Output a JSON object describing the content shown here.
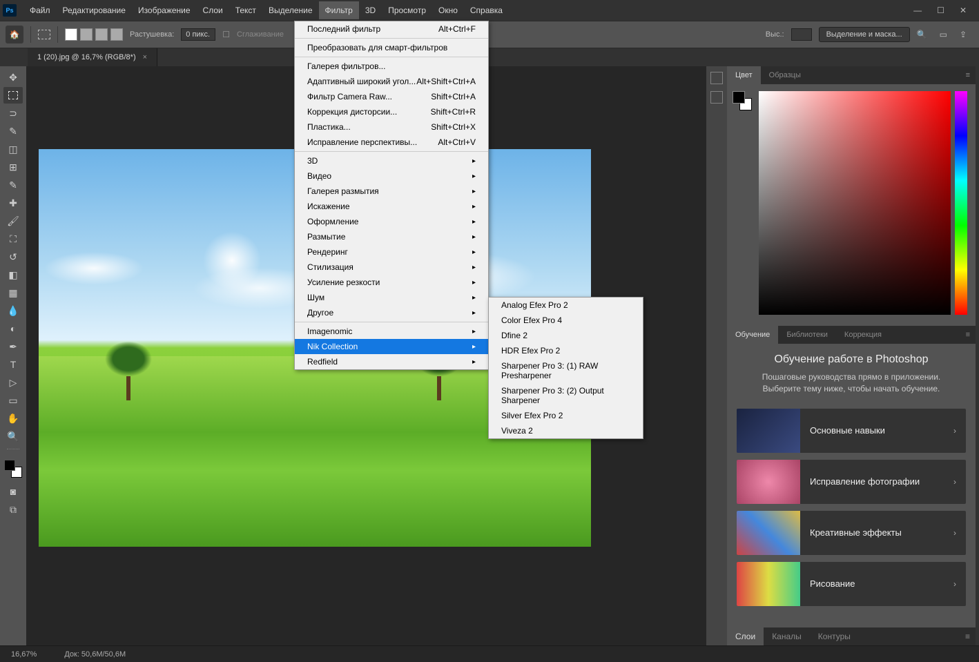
{
  "app_badge": "Ps",
  "menubar": {
    "items": [
      "Файл",
      "Редактирование",
      "Изображение",
      "Слои",
      "Текст",
      "Выделение",
      "Фильтр",
      "3D",
      "Просмотр",
      "Окно",
      "Справка"
    ],
    "active_index": 6
  },
  "options": {
    "feather_label": "Растушевка:",
    "feather_value": "0 пикс.",
    "antialias_label": "Сглаживание",
    "height_label": "Выс.:",
    "select_mask_button": "Выделение и маска..."
  },
  "doc_tab": {
    "title": "1 (20).jpg @ 16,7% (RGB/8*)"
  },
  "filter_menu": {
    "last_filter": {
      "label": "Последний фильтр",
      "shortcut": "Alt+Ctrl+F"
    },
    "convert_smart": {
      "label": "Преобразовать для смарт-фильтров"
    },
    "section2": [
      {
        "label": "Галерея фильтров..."
      },
      {
        "label": "Адаптивный широкий угол...",
        "shortcut": "Alt+Shift+Ctrl+A"
      },
      {
        "label": "Фильтр Camera Raw...",
        "shortcut": "Shift+Ctrl+A"
      },
      {
        "label": "Коррекция дисторсии...",
        "shortcut": "Shift+Ctrl+R"
      },
      {
        "label": "Пластика...",
        "shortcut": "Shift+Ctrl+X"
      },
      {
        "label": "Исправление перспективы...",
        "shortcut": "Alt+Ctrl+V"
      }
    ],
    "section3": [
      "3D",
      "Видео",
      "Галерея размытия",
      "Искажение",
      "Оформление",
      "Размытие",
      "Рендеринг",
      "Стилизация",
      "Усиление резкости",
      "Шум",
      "Другое"
    ],
    "section4": [
      "Imagenomic",
      "Nik Collection",
      "Redfield"
    ],
    "highlighted": "Nik Collection"
  },
  "nik_submenu": [
    "Analog Efex Pro 2",
    "Color Efex Pro 4",
    "Dfine 2",
    "HDR Efex Pro 2",
    "Sharpener Pro 3: (1) RAW Presharpener",
    "Sharpener Pro 3: (2) Output Sharpener",
    "Silver Efex Pro 2",
    "Viveza 2"
  ],
  "panels": {
    "color_tabs": [
      "Цвет",
      "Образцы"
    ],
    "mid_tabs": [
      "Обучение",
      "Библиотеки",
      "Коррекция"
    ],
    "learn": {
      "title": "Обучение работе в Photoshop",
      "subtitle": "Пошаговые руководства прямо в приложении. Выберите тему ниже, чтобы начать обучение.",
      "cards": [
        "Основные навыки",
        "Исправление фотографии",
        "Креативные эффекты",
        "Рисование"
      ]
    },
    "bottom_tabs": [
      "Слои",
      "Каналы",
      "Контуры"
    ]
  },
  "status": {
    "zoom": "16,67%",
    "doc": "Док: 50,6M/50,6M"
  }
}
